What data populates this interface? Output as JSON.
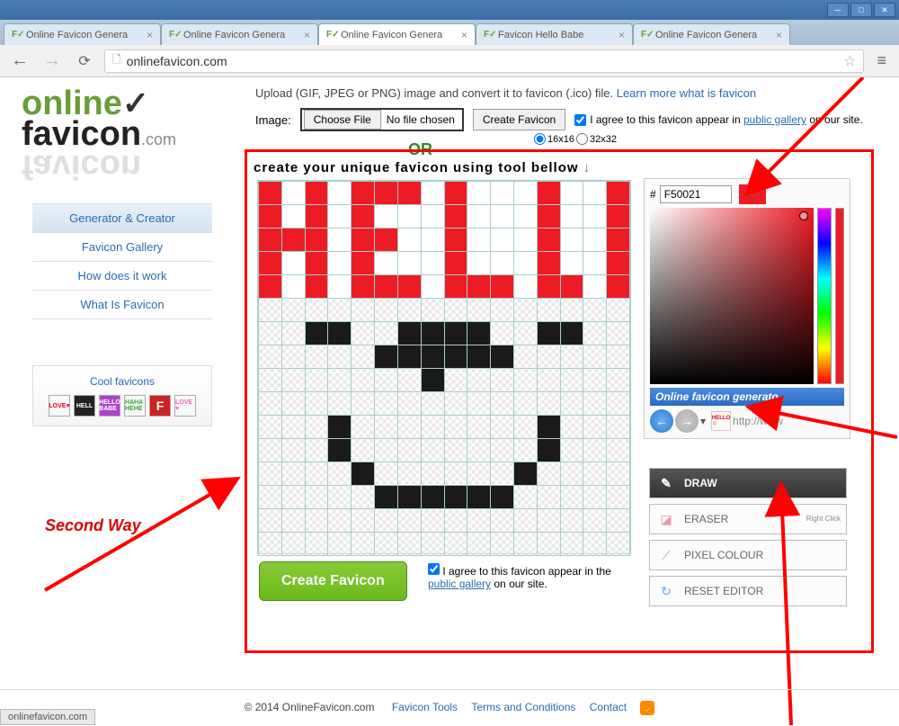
{
  "browser": {
    "tabs": [
      {
        "title": "Online Favicon Genera",
        "active": false
      },
      {
        "title": "Online Favicon Genera",
        "active": false
      },
      {
        "title": "Online Favicon Genera",
        "active": true
      },
      {
        "title": "Favicon Hello Babe",
        "active": false
      },
      {
        "title": "Online Favicon Genera",
        "active": false
      }
    ],
    "url": "onlinefavicon.com",
    "status": "onlinefavicon.com"
  },
  "upload": {
    "text": "Upload (GIF, JPEG or PNG) image and convert it to favicon (.ico) file. ",
    "learn_link": "Learn more what is favicon",
    "image_label": "Image:",
    "choose_btn": "Choose File",
    "no_file": "No file chosen",
    "create_btn": "Create Favicon",
    "agree_text": "I agree to this favicon appear in ",
    "gallery_link": "public gallery",
    "agree_suffix": " on our site.",
    "size_16": "16x16",
    "size_32": "32x32",
    "or": "OR"
  },
  "sidebar": {
    "items": [
      "Generator & Creator",
      "Favicon Gallery",
      "How does it work",
      "What Is Favicon"
    ]
  },
  "cool": {
    "title": "Cool favicons",
    "icons": [
      {
        "label": "LOVE♥",
        "bg": "#fff",
        "color": "#e02"
      },
      {
        "label": "HELL",
        "bg": "#222",
        "color": "#fff"
      },
      {
        "label": "HELLO BABE",
        "bg": "#a4c",
        "color": "#fff"
      },
      {
        "label": "HAHA HEHE",
        "bg": "#fff",
        "color": "#3a3"
      },
      {
        "label": "F",
        "bg": "#c22",
        "color": "#fff"
      },
      {
        "label": "LOVE ♥",
        "bg": "#fff",
        "color": "#e6a"
      }
    ]
  },
  "editor": {
    "title": "create your unique favicon using tool bellow ",
    "arrow": "↓",
    "create_btn": "Create Favicon",
    "agree_text": "I agree to this favicon appear in the ",
    "gallery_link": "public gallery",
    "agree_suffix": " on our site."
  },
  "color": {
    "hash": "#",
    "hex": "F50021",
    "banner": "Online favicon generato",
    "url_preview": "http://www"
  },
  "tools": {
    "draw": "DRAW",
    "eraser": "ERASER",
    "eraser_hint": "Right\nClick",
    "pixel": "PIXEL COLOUR",
    "reset": "RESET EDITOR"
  },
  "footer": {
    "copyright": "© 2014 OnlineFavicon.com",
    "links": [
      "Favicon Tools",
      "Terms and Conditions",
      "Contact"
    ]
  },
  "annotation": {
    "second_way": "Second Way"
  },
  "logo": {
    "online": "online",
    "favicon": "favicon",
    "com": ".com"
  }
}
